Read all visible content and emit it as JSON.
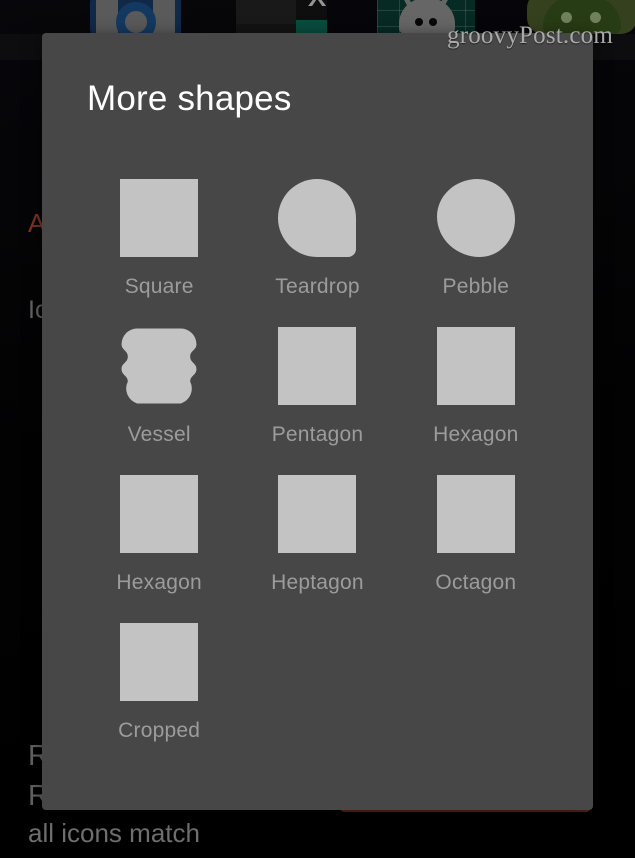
{
  "watermark": "groovyPost.com",
  "dialog": {
    "title": "More shapes",
    "shapes": [
      {
        "label": "Square",
        "icon": "square-shape"
      },
      {
        "label": "Teardrop",
        "icon": "teardrop-shape"
      },
      {
        "label": "Pebble",
        "icon": "pebble-shape"
      },
      {
        "label": "Vessel",
        "icon": "vessel-shape"
      },
      {
        "label": "Pentagon",
        "icon": "pentagon-shape"
      },
      {
        "label": "Hexagon",
        "icon": "hexagon-flat-shape"
      },
      {
        "label": "Hexagon",
        "icon": "hexagon-pointy-shape"
      },
      {
        "label": "Heptagon",
        "icon": "heptagon-shape"
      },
      {
        "label": "Octagon",
        "icon": "octagon-shape"
      },
      {
        "label": "Cropped",
        "icon": "cropped-square-shape"
      }
    ]
  },
  "background": {
    "title_partial": "A",
    "subtitle_partial": "Ic",
    "row1_partial": "R",
    "row2_partial": "R",
    "row3_partial": "all icons match"
  },
  "colors": {
    "dialog_background": "#474747",
    "shape_fill": "#c3c3c3",
    "title_text": "#ffffff",
    "label_text": "#9c9c9c",
    "accent_red": "#b5482c"
  }
}
